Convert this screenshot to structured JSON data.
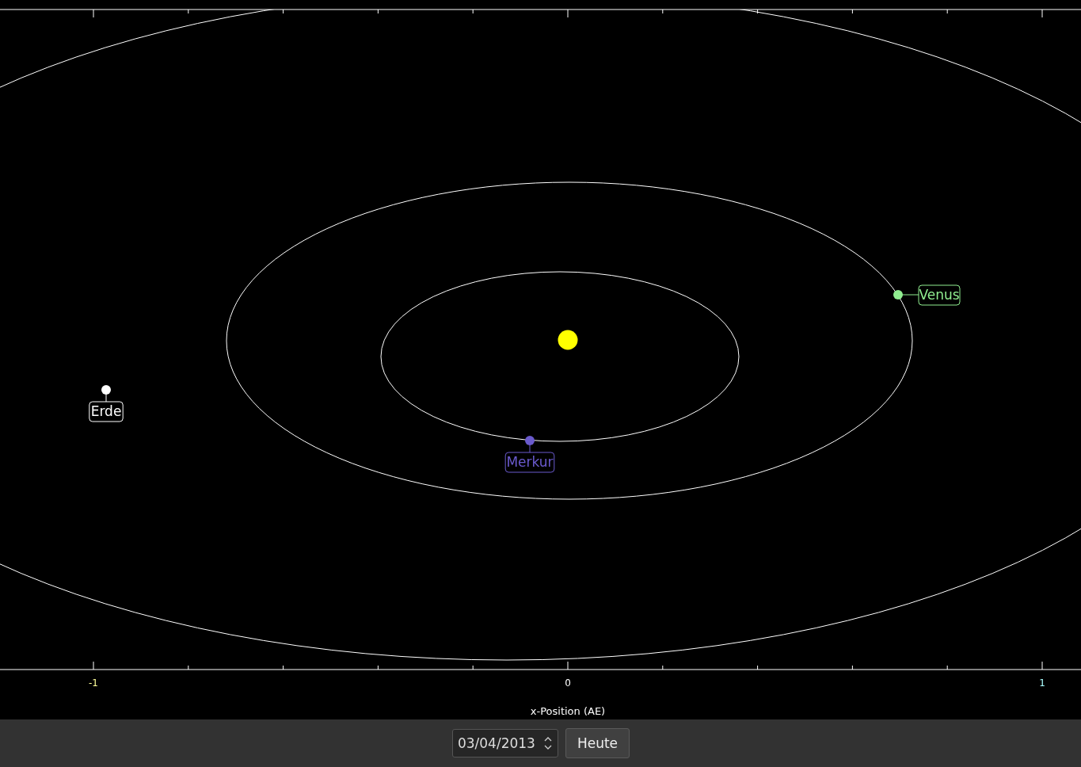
{
  "plot": {
    "x_axis": {
      "tick_labels": [
        "-1",
        "0",
        "1"
      ],
      "label": "x-Position (AE)"
    },
    "planets": [
      {
        "name": "Merkur",
        "color": "#6a5acd"
      },
      {
        "name": "Venus",
        "color": "#90ee90"
      },
      {
        "name": "Erde",
        "color": "#ffffff"
      }
    ]
  },
  "controls": {
    "date_value": "03/04/2013",
    "today_button": "Heute"
  }
}
